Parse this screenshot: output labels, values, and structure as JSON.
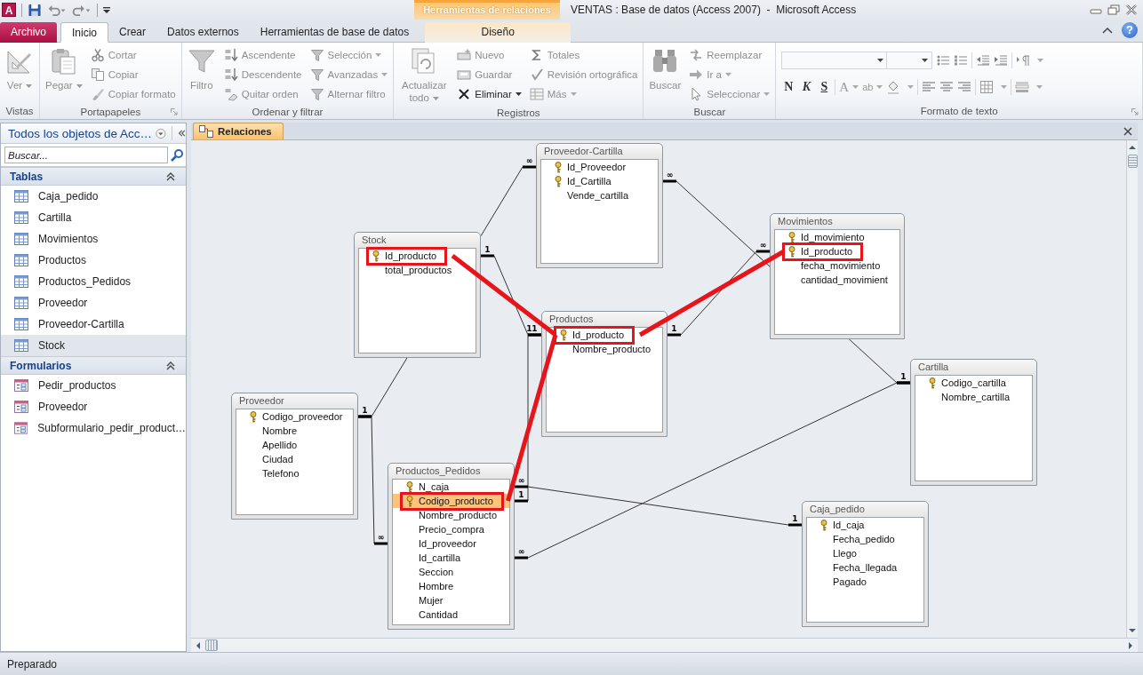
{
  "title_bar": {
    "app_letter": "A",
    "context_header": "Herramientas de relaciones",
    "title": "VENTAS : Base de datos (Access 2007)  -  Microsoft Access"
  },
  "tabs": [
    {
      "label": "Archivo",
      "kind": "file",
      "selected": false
    },
    {
      "label": "Inicio",
      "kind": "tab",
      "selected": true
    },
    {
      "label": "Crear",
      "kind": "tab",
      "selected": false
    },
    {
      "label": "Datos externos",
      "kind": "tab",
      "selected": false
    },
    {
      "label": "Herramientas de base de datos",
      "kind": "tab",
      "selected": false
    },
    {
      "label": "Diseño",
      "kind": "context",
      "selected": false
    }
  ],
  "help": "?",
  "ribbon": {
    "groups": [
      {
        "label": "Vistas",
        "large": [
          {
            "label": "Ver",
            "dropdown": true,
            "disabled": true
          }
        ]
      },
      {
        "label": "Portapapeles",
        "launcher": true,
        "large": [
          {
            "label": "Pegar",
            "dropdown": true,
            "disabled": true
          }
        ],
        "columns": [
          [
            {
              "label": "Cortar",
              "dropdown": false,
              "disabled": true
            },
            {
              "label": "Copiar",
              "dropdown": false,
              "disabled": true
            },
            {
              "label": "Copiar formato",
              "dropdown": false,
              "disabled": true
            }
          ]
        ]
      },
      {
        "label": "Ordenar y filtrar",
        "large": [
          {
            "label": "Filtro",
            "dropdown": false,
            "disabled": true
          }
        ],
        "columns": [
          [
            {
              "label": "Ascendente",
              "dropdown": false,
              "disabled": true
            },
            {
              "label": "Descendente",
              "dropdown": false,
              "disabled": true
            },
            {
              "label": "Quitar orden",
              "dropdown": false,
              "disabled": true
            }
          ],
          [
            {
              "label": "Selección",
              "dropdown": true,
              "disabled": true
            },
            {
              "label": "Avanzadas",
              "dropdown": true,
              "disabled": true
            },
            {
              "label": "Alternar filtro",
              "dropdown": false,
              "disabled": true
            }
          ]
        ]
      },
      {
        "label": "Registros",
        "large": [
          {
            "label": "Actualizar todo",
            "dropdown": true,
            "disabled": true
          }
        ],
        "columns": [
          [
            {
              "label": "Nuevo",
              "dropdown": false,
              "disabled": true
            },
            {
              "label": "Guardar",
              "dropdown": false,
              "disabled": true
            },
            {
              "label": "Eliminar",
              "dropdown": true,
              "disabled": false
            }
          ],
          [
            {
              "label": "Totales",
              "dropdown": false,
              "disabled": true
            },
            {
              "label": "Revisión ortográfica",
              "dropdown": false,
              "disabled": true
            },
            {
              "label": "Más",
              "dropdown": true,
              "disabled": true
            }
          ]
        ]
      },
      {
        "label": "Buscar",
        "large": [
          {
            "label": "Buscar",
            "dropdown": false,
            "disabled": true
          }
        ],
        "columns": [
          [
            {
              "label": "Reemplazar",
              "dropdown": false,
              "disabled": true
            },
            {
              "label": "Ir a",
              "dropdown": true,
              "disabled": true
            },
            {
              "label": "Seleccionar",
              "dropdown": true,
              "disabled": true
            }
          ]
        ]
      }
    ],
    "text_format": {
      "label": "Formato de texto",
      "launcher": true,
      "style_buttons": [
        "N",
        "K",
        "S"
      ],
      "color_buttons": [
        "A",
        "ab"
      ]
    }
  },
  "nav": {
    "title": "Todos los objetos de Acc…",
    "search": {
      "placeholder": "Buscar..."
    },
    "groups": [
      {
        "label": "Tablas",
        "kind": "table",
        "expanded": true,
        "items": [
          {
            "label": "Caja_pedido",
            "selected": false
          },
          {
            "label": "Cartilla",
            "selected": false
          },
          {
            "label": "Movimientos",
            "selected": false
          },
          {
            "label": "Productos",
            "selected": false
          },
          {
            "label": "Productos_Pedidos",
            "selected": false
          },
          {
            "label": "Proveedor",
            "selected": false
          },
          {
            "label": "Proveedor-Cartilla",
            "selected": false
          },
          {
            "label": "Stock",
            "selected": true
          }
        ]
      },
      {
        "label": "Formularios",
        "kind": "form",
        "expanded": true,
        "items": [
          {
            "label": "Pedir_productos",
            "selected": false
          },
          {
            "label": "Proveedor",
            "selected": false
          },
          {
            "label": "Subformulario_pedir_product…",
            "selected": false
          }
        ]
      }
    ]
  },
  "document": {
    "tabs": [
      {
        "label": "Relaciones",
        "selected": true
      }
    ]
  },
  "tables": [
    {
      "name": "Proveedor-Cartilla",
      "fields": [
        {
          "name": "Id_Proveedor",
          "key": true,
          "selected": false,
          "highlighted": false
        },
        {
          "name": "Id_Cartilla",
          "key": true,
          "selected": false,
          "highlighted": false
        },
        {
          "name": "Vende_cartilla",
          "key": false,
          "selected": false,
          "highlighted": false
        }
      ]
    },
    {
      "name": "Stock",
      "fields": [
        {
          "name": "Id_producto",
          "key": true,
          "selected": false,
          "highlighted": true
        },
        {
          "name": "total_productos",
          "key": false,
          "selected": false,
          "highlighted": false
        }
      ]
    },
    {
      "name": "Movimientos",
      "fields": [
        {
          "name": "Id_movimiento",
          "key": true,
          "selected": false,
          "highlighted": false
        },
        {
          "name": "Id_producto",
          "key": true,
          "selected": false,
          "highlighted": true
        },
        {
          "name": "fecha_movimiento",
          "key": false,
          "selected": false,
          "highlighted": false
        },
        {
          "name": "cantidad_movimient",
          "key": false,
          "selected": false,
          "highlighted": false
        }
      ]
    },
    {
      "name": "Productos",
      "fields": [
        {
          "name": "Id_producto",
          "key": true,
          "selected": false,
          "highlighted": true
        },
        {
          "name": "Nombre_producto",
          "key": false,
          "selected": false,
          "highlighted": false
        }
      ]
    },
    {
      "name": "Cartilla",
      "fields": [
        {
          "name": "Codigo_cartilla",
          "key": true,
          "selected": false,
          "highlighted": false
        },
        {
          "name": "Nombre_cartilla",
          "key": false,
          "selected": false,
          "highlighted": false
        }
      ]
    },
    {
      "name": "Proveedor",
      "fields": [
        {
          "name": "Codigo_proveedor",
          "key": true,
          "selected": false,
          "highlighted": false
        },
        {
          "name": "Nombre",
          "key": false,
          "selected": false,
          "highlighted": false
        },
        {
          "name": "Apellido",
          "key": false,
          "selected": false,
          "highlighted": false
        },
        {
          "name": "Ciudad",
          "key": false,
          "selected": false,
          "highlighted": false
        },
        {
          "name": "Telefono",
          "key": false,
          "selected": false,
          "highlighted": false
        }
      ]
    },
    {
      "name": "Productos_Pedidos",
      "fields": [
        {
          "name": "N_caja",
          "key": true,
          "selected": false,
          "highlighted": false
        },
        {
          "name": "Codigo_producto",
          "key": true,
          "selected": true,
          "highlighted": true
        },
        {
          "name": "Nombre_producto",
          "key": false,
          "selected": false,
          "highlighted": false
        },
        {
          "name": "Precio_compra",
          "key": false,
          "selected": false,
          "highlighted": false
        },
        {
          "name": "Id_proveedor",
          "key": false,
          "selected": false,
          "highlighted": false
        },
        {
          "name": "Id_cartilla",
          "key": false,
          "selected": false,
          "highlighted": false
        },
        {
          "name": "Seccion",
          "key": false,
          "selected": false,
          "highlighted": false
        },
        {
          "name": "Hombre",
          "key": false,
          "selected": false,
          "highlighted": false
        },
        {
          "name": "Mujer",
          "key": false,
          "selected": false,
          "highlighted": false
        },
        {
          "name": "Cantidad",
          "key": false,
          "selected": false,
          "highlighted": false
        }
      ]
    },
    {
      "name": "Caja_pedido",
      "fields": [
        {
          "name": "Id_caja",
          "key": true,
          "selected": false,
          "highlighted": false
        },
        {
          "name": "Fecha_pedido",
          "key": false,
          "selected": false,
          "highlighted": false
        },
        {
          "name": "Llego",
          "key": false,
          "selected": false,
          "highlighted": false
        },
        {
          "name": "Fecha_llegada",
          "key": false,
          "selected": false,
          "highlighted": false
        },
        {
          "name": "Pagado",
          "key": false,
          "selected": false,
          "highlighted": false
        }
      ]
    }
  ],
  "relationships": [
    {
      "from_end": "∞"
    },
    {
      "from_end": "∞",
      "to_end": "1"
    },
    {
      "from_end": "1",
      "to_end": "1"
    },
    {
      "from_end": "1",
      "to_end": "∞"
    },
    {
      "from_end": "1",
      "to_end": "1"
    },
    {
      "from_end": "∞",
      "to_end": "1"
    },
    {
      "from_end": "∞",
      "to_end": "1"
    },
    {
      "from_end": "∞"
    }
  ],
  "status_bar": {
    "text": "Preparado"
  }
}
